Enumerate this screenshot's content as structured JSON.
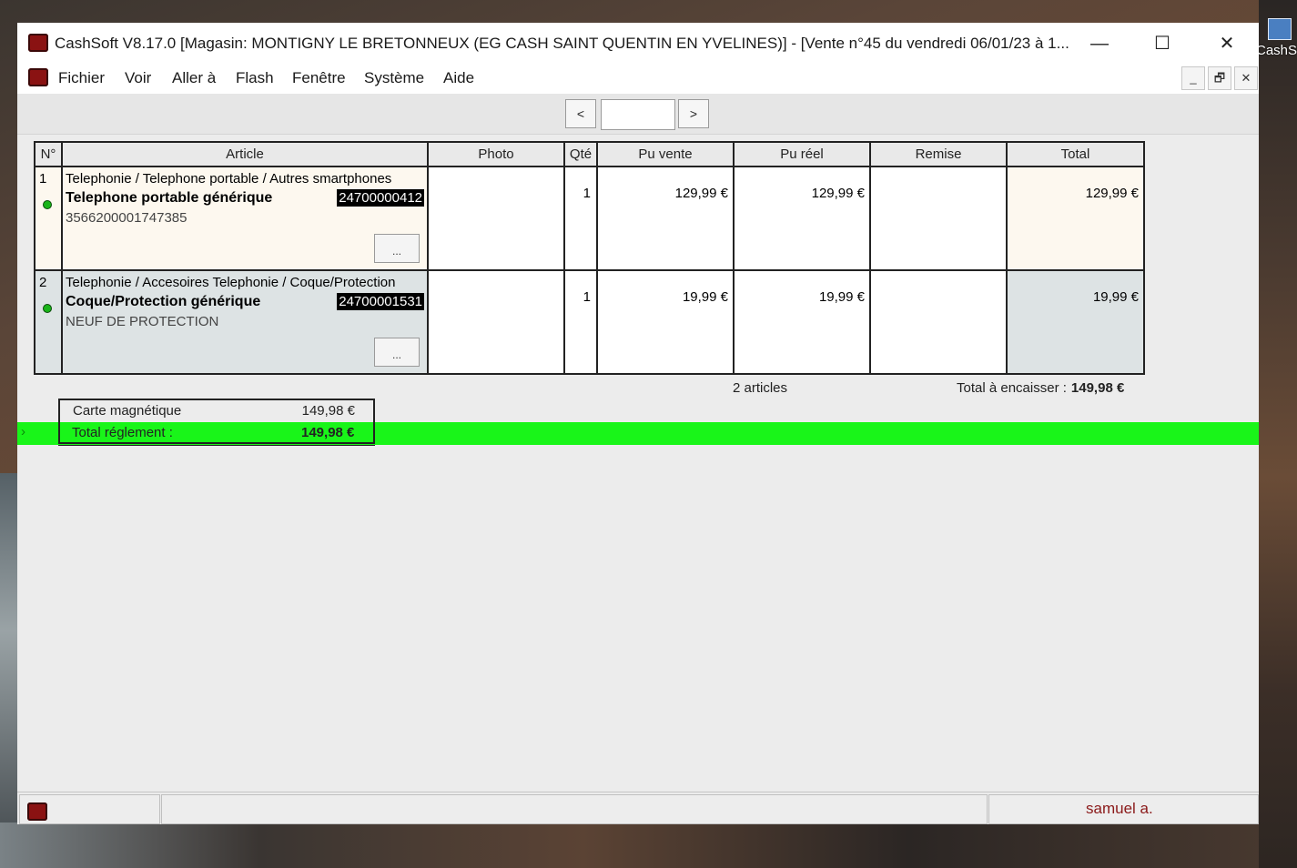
{
  "window": {
    "title": "CashSoft V8.17.0 [Magasin: MONTIGNY LE BRETONNEUX (EG CASH SAINT QUENTIN EN YVELINES)] - [Vente n°45 du vendredi 06/01/23 à 1...",
    "minimize_glyph": "—",
    "maximize_glyph": "☐",
    "close_glyph": "✕"
  },
  "desktop": {
    "icon_label": "CashS"
  },
  "menu": {
    "items": [
      "Fichier",
      "Voir",
      "Aller à",
      "Flash",
      "Fenêtre",
      "Système",
      "Aide"
    ],
    "mdi_minimize": "_",
    "mdi_restore": "🗗",
    "mdi_close": "✕"
  },
  "toolbar": {
    "prev_label": "<",
    "next_label": ">",
    "page_value": ""
  },
  "table": {
    "headers": [
      "N°",
      "Article",
      "Photo",
      "Qté",
      "Pu vente",
      "Pu réel",
      "Remise",
      "Total"
    ],
    "rows": [
      {
        "num": "1",
        "path": "Telephonie / Telephone portable / Autres smartphones",
        "name": "Telephone portable générique",
        "code": "24700000412",
        "extra": "3566200001747385",
        "more": "...",
        "qty": "1",
        "pu_vente": "129,99 €",
        "pu_reel": "129,99 €",
        "remise": "",
        "total": "129,99 €"
      },
      {
        "num": "2",
        "path": "Telephonie / Accesoires Telephonie / Coque/Protection",
        "name": "Coque/Protection générique",
        "code": "24700001531",
        "extra": "NEUF DE PROTECTION",
        "more": "...",
        "qty": "1",
        "pu_vente": "19,99 €",
        "pu_reel": "19,99 €",
        "remise": "",
        "total": "19,99 €"
      }
    ]
  },
  "summary": {
    "articles_count": "2 articles",
    "total_label": "Total à encaisser :",
    "total_value": "149,98 €"
  },
  "payment": {
    "method_label": "Carte magnétique",
    "method_value": "149,98 €",
    "total_label": "Total réglement :",
    "total_value": "149,98 €",
    "arrow": "›"
  },
  "status": {
    "user": "samuel a."
  },
  "colors": {
    "accent_green": "#19f519",
    "user_text": "#8b1a1a"
  }
}
